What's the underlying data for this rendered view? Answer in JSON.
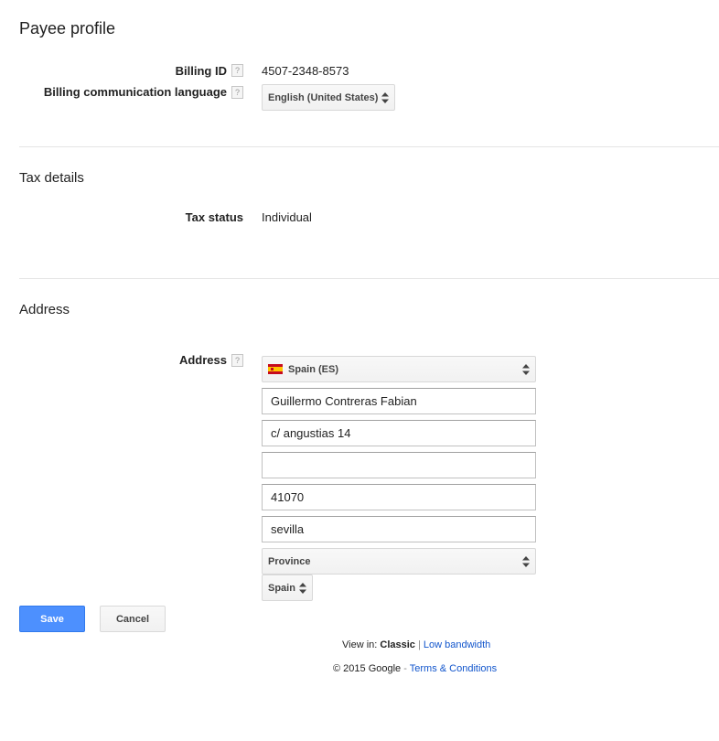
{
  "page": {
    "title": "Payee profile"
  },
  "payee_profile": {
    "billing_id_label": "Billing ID",
    "billing_id_value": "4507-2348-8573",
    "language_label": "Billing communication language",
    "language_value": "English (United States)"
  },
  "tax_details": {
    "title": "Tax details",
    "tax_status_label": "Tax status",
    "tax_status_value": "Individual"
  },
  "address": {
    "title": "Address",
    "label": "Address",
    "country": "Spain (ES)",
    "name": "Guillermo Contreras Fabian",
    "line1": "c/ angustias 14",
    "line2": "",
    "postal_code": "41070",
    "city": "sevilla",
    "province": "Province",
    "country_small": "Spain"
  },
  "help_glyph": "?",
  "actions": {
    "save_label": "Save",
    "cancel_label": "Cancel"
  },
  "footer": {
    "view_in_prefix": "View in:",
    "classic": "Classic",
    "separator": "|",
    "low_bandwidth": "Low bandwidth",
    "copyright": "© 2015 Google",
    "dash": "-",
    "terms": "Terms & Conditions"
  },
  "colors": {
    "primary_button": "#4d90fe",
    "link": "#1155cc",
    "divider": "#e5e5e5"
  },
  "icons": {
    "help": "help-icon",
    "select_arrows": "select-arrows-icon",
    "flag": "spain-flag-icon"
  }
}
